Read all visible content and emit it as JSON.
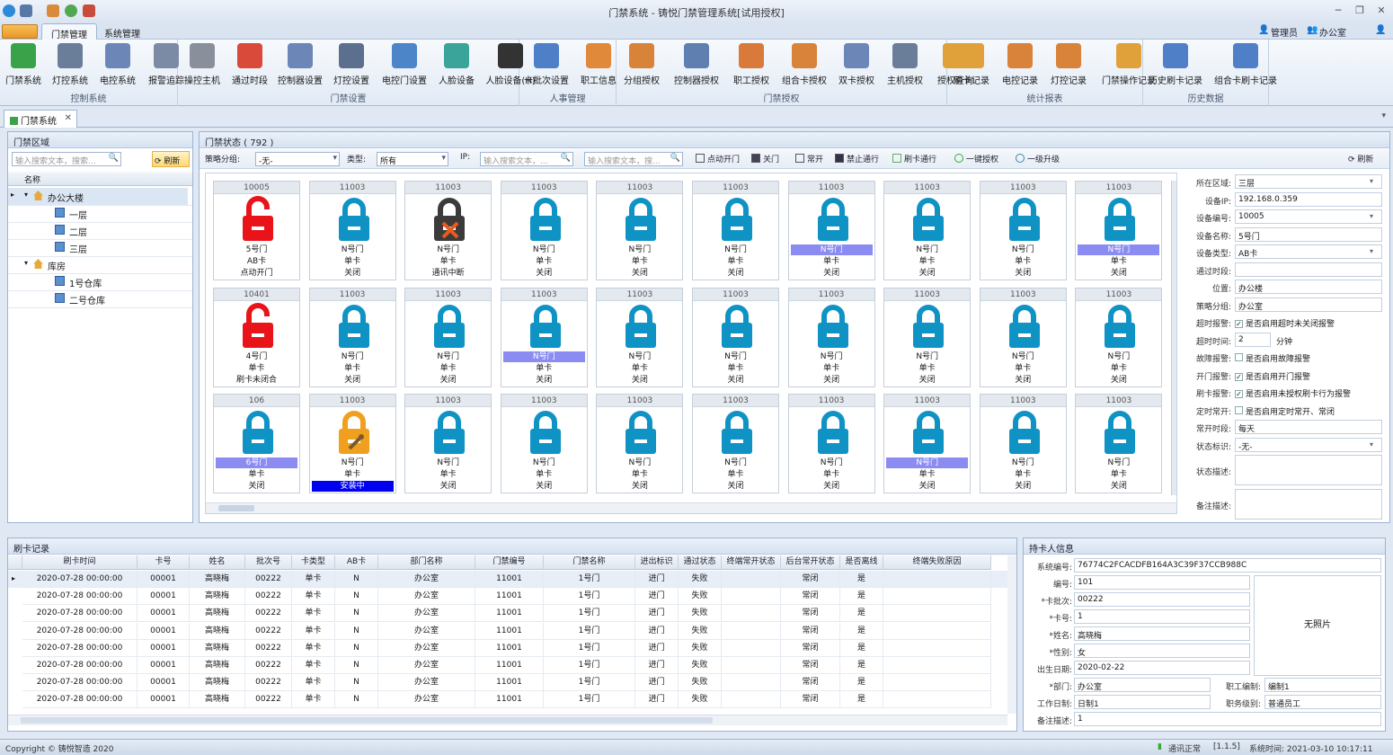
{
  "app": {
    "title": "门禁系统 - 铸悦门禁管理系统[试用授权]"
  },
  "menu": {
    "tabs": [
      "门禁管理",
      "系统管理"
    ],
    "user": "管理员",
    "dept": "办公室"
  },
  "ribbon": {
    "groups": [
      {
        "label": "控制系统",
        "buttons": [
          {
            "label": "门禁系统",
            "color": "#3aa34a"
          },
          {
            "label": "灯控系统",
            "color": "#6b7e99"
          },
          {
            "label": "电控系统",
            "color": "#6d86b8"
          },
          {
            "label": "报警追踪",
            "color": "#7b8aa5"
          }
        ]
      },
      {
        "label": "门禁设置",
        "buttons": [
          {
            "label": "操控主机",
            "color": "#8a8f9c"
          },
          {
            "label": "通过时段",
            "color": "#d94a3a"
          },
          {
            "label": "控制器设置",
            "color": "#6d86b8"
          },
          {
            "label": "灯控设置",
            "color": "#5d6f8e"
          },
          {
            "label": "电控门设置",
            "color": "#4d85c9"
          },
          {
            "label": "人脸设备",
            "color": "#3aa39a"
          },
          {
            "label": "人脸设备(H)",
            "color": "#333333"
          }
        ]
      },
      {
        "label": "人事管理",
        "buttons": [
          {
            "label": "卡批次设置",
            "color": "#4f7fc7"
          },
          {
            "label": "职工信息",
            "color": "#e0893a"
          }
        ]
      },
      {
        "label": "门禁授权",
        "buttons": [
          {
            "label": "分组授权",
            "color": "#d9823a"
          },
          {
            "label": "控制器授权",
            "color": "#5f7fb0"
          },
          {
            "label": "职工授权",
            "color": "#d97a3a"
          },
          {
            "label": "组合卡授权",
            "color": "#d9823a"
          },
          {
            "label": "双卡授权",
            "color": "#6d86b8"
          },
          {
            "label": "主机授权",
            "color": "#6b7e99"
          },
          {
            "label": "授权查询",
            "color": "#e0a03a"
          }
        ]
      },
      {
        "label": "统计报表",
        "buttons": [
          {
            "label": "刷卡记录",
            "color": "#e0a03a"
          },
          {
            "label": "电控记录",
            "color": "#d9823a"
          },
          {
            "label": "灯控记录",
            "color": "#d9823a"
          },
          {
            "label": "门禁操作记录",
            "color": "#e0a03a"
          }
        ]
      },
      {
        "label": "历史数据",
        "buttons": [
          {
            "label": "历史刷卡记录",
            "color": "#4f7fc7"
          },
          {
            "label": "组合卡刷卡记录",
            "color": "#4f7fc7"
          }
        ]
      }
    ]
  },
  "doc_tab": "门禁系统",
  "area_panel": {
    "title": "门禁区域",
    "search_placeholder": "输入搜索文本，搜索...",
    "refresh": "刷新",
    "col_name": "名称",
    "tree": [
      {
        "label": "办公大楼",
        "level": 0,
        "type": "building"
      },
      {
        "label": "一层",
        "level": 1,
        "type": "floor"
      },
      {
        "label": "二层",
        "level": 1,
        "type": "floor"
      },
      {
        "label": "三层",
        "level": 1,
        "type": "floor"
      },
      {
        "label": "库房",
        "level": 0,
        "type": "building"
      },
      {
        "label": "1号仓库",
        "level": 1,
        "type": "floor"
      },
      {
        "label": "二号仓库",
        "level": 1,
        "type": "floor"
      }
    ]
  },
  "status_panel": {
    "title": "门禁状态 ( 792 )",
    "group_label": "策略分组:",
    "group_value": "-无-",
    "type_label": "类型:",
    "type_value": "所有",
    "ip_label": "IP:",
    "ip_placeholder": "输入搜索文本，...",
    "search_placeholder": "输入搜索文本，搜...",
    "actions": [
      "点动开门",
      "关门",
      "常开",
      "禁止通行",
      "刷卡通行",
      "一键授权",
      "一级升级"
    ],
    "refresh": "刷新",
    "doors": [
      {
        "id": "10005",
        "name": "5号门",
        "type": "AB卡",
        "status": "点动开门",
        "icon": "open-red",
        "hl": false,
        "inst": false
      },
      {
        "id": "11003",
        "name": "N号门",
        "type": "单卡",
        "status": "关闭",
        "icon": "closed",
        "hl": false,
        "inst": false
      },
      {
        "id": "11003",
        "name": "N号门",
        "type": "单卡",
        "status": "通讯中断",
        "icon": "offline",
        "hl": false,
        "inst": false
      },
      {
        "id": "11003",
        "name": "N号门",
        "type": "单卡",
        "status": "关闭",
        "icon": "closed",
        "hl": false,
        "inst": false
      },
      {
        "id": "11003",
        "name": "N号门",
        "type": "单卡",
        "status": "关闭",
        "icon": "closed",
        "hl": false,
        "inst": false
      },
      {
        "id": "11003",
        "name": "N号门",
        "type": "单卡",
        "status": "关闭",
        "icon": "closed",
        "hl": false,
        "inst": false
      },
      {
        "id": "11003",
        "name": "N号门",
        "type": "单卡",
        "status": "关闭",
        "icon": "closed",
        "hl": true,
        "inst": false
      },
      {
        "id": "11003",
        "name": "N号门",
        "type": "单卡",
        "status": "关闭",
        "icon": "closed",
        "hl": false,
        "inst": false
      },
      {
        "id": "11003",
        "name": "N号门",
        "type": "单卡",
        "status": "关闭",
        "icon": "closed",
        "hl": false,
        "inst": false
      },
      {
        "id": "11003",
        "name": "N号门",
        "type": "单卡",
        "status": "关闭",
        "icon": "closed",
        "hl": true,
        "inst": false
      },
      {
        "id": "10401",
        "name": "4号门",
        "type": "单卡",
        "status": "刷卡未闭合",
        "icon": "open-red",
        "hl": false,
        "inst": false
      },
      {
        "id": "11003",
        "name": "N号门",
        "type": "单卡",
        "status": "关闭",
        "icon": "closed",
        "hl": false,
        "inst": false
      },
      {
        "id": "11003",
        "name": "N号门",
        "type": "单卡",
        "status": "关闭",
        "icon": "closed",
        "hl": false,
        "inst": false
      },
      {
        "id": "11003",
        "name": "N号门",
        "type": "单卡",
        "status": "关闭",
        "icon": "closed",
        "hl": true,
        "inst": false
      },
      {
        "id": "11003",
        "name": "N号门",
        "type": "单卡",
        "status": "关闭",
        "icon": "closed",
        "hl": false,
        "inst": false
      },
      {
        "id": "11003",
        "name": "N号门",
        "type": "单卡",
        "status": "关闭",
        "icon": "closed",
        "hl": false,
        "inst": false
      },
      {
        "id": "11003",
        "name": "N号门",
        "type": "单卡",
        "status": "关闭",
        "icon": "closed",
        "hl": false,
        "inst": false
      },
      {
        "id": "11003",
        "name": "N号门",
        "type": "单卡",
        "status": "关闭",
        "icon": "closed",
        "hl": false,
        "inst": false
      },
      {
        "id": "11003",
        "name": "N号门",
        "type": "单卡",
        "status": "关闭",
        "icon": "closed",
        "hl": false,
        "inst": false
      },
      {
        "id": "11003",
        "name": "N号门",
        "type": "单卡",
        "status": "关闭",
        "icon": "closed",
        "hl": false,
        "inst": false
      },
      {
        "id": "106",
        "name": "6号门",
        "type": "单卡",
        "status": "关闭",
        "icon": "closed",
        "hl": true,
        "inst": false
      },
      {
        "id": "11003",
        "name": "N号门",
        "type": "单卡",
        "status": "安装中",
        "icon": "install",
        "hl": false,
        "inst": true
      },
      {
        "id": "11003",
        "name": "N号门",
        "type": "单卡",
        "status": "关闭",
        "icon": "closed",
        "hl": false,
        "inst": false
      },
      {
        "id": "11003",
        "name": "N号门",
        "type": "单卡",
        "status": "关闭",
        "icon": "closed",
        "hl": false,
        "inst": false
      },
      {
        "id": "11003",
        "name": "N号门",
        "type": "单卡",
        "status": "关闭",
        "icon": "closed",
        "hl": false,
        "inst": false
      },
      {
        "id": "11003",
        "name": "N号门",
        "type": "单卡",
        "status": "关闭",
        "icon": "closed",
        "hl": false,
        "inst": false
      },
      {
        "id": "11003",
        "name": "N号门",
        "type": "单卡",
        "status": "关闭",
        "icon": "closed",
        "hl": false,
        "inst": false
      },
      {
        "id": "11003",
        "name": "N号门",
        "type": "单卡",
        "status": "关闭",
        "icon": "closed",
        "hl": true,
        "inst": false
      },
      {
        "id": "11003",
        "name": "N号门",
        "type": "单卡",
        "status": "关闭",
        "icon": "closed",
        "hl": false,
        "inst": false
      },
      {
        "id": "11003",
        "name": "N号门",
        "type": "单卡",
        "status": "关闭",
        "icon": "closed",
        "hl": false,
        "inst": false
      }
    ]
  },
  "properties": [
    {
      "label": "所在区域:",
      "value": "三层",
      "kind": "combo"
    },
    {
      "label": "设备IP:",
      "value": "192.168.0.359",
      "kind": "text"
    },
    {
      "label": "设备编号:",
      "value": "10005",
      "kind": "spin"
    },
    {
      "label": "设备名称:",
      "value": "5号门",
      "kind": "text"
    },
    {
      "label": "设备类型:",
      "value": "AB卡",
      "kind": "combo"
    },
    {
      "label": "通过时段:",
      "value": "",
      "kind": "text"
    },
    {
      "label": "位置:",
      "value": "办公楼",
      "kind": "text"
    },
    {
      "label": "策略分组:",
      "value": "办公室",
      "kind": "text"
    },
    {
      "label": "超时报警:",
      "value": "是否启用超时未关闭报警",
      "kind": "check",
      "checked": true
    },
    {
      "label": "超时时间:",
      "value": "2",
      "unit": "分钟",
      "kind": "spinunit"
    },
    {
      "label": "故障报警:",
      "value": "是否启用故障报警",
      "kind": "check",
      "checked": false
    },
    {
      "label": "开门报警:",
      "value": "是否启用开门报警",
      "kind": "check",
      "checked": true
    },
    {
      "label": "刷卡报警:",
      "value": "是否启用未授权刷卡行为报警",
      "kind": "check",
      "checked": true
    },
    {
      "label": "定时常开:",
      "value": "是否启用定时常开、常闭",
      "kind": "check",
      "checked": false
    },
    {
      "label": "常开时段:",
      "value": "每天",
      "kind": "text"
    },
    {
      "label": "状态标识:",
      "value": "-无-",
      "kind": "combo"
    },
    {
      "label": "状态描述:",
      "value": "",
      "kind": "memo"
    },
    {
      "label": "备注描述:",
      "value": "",
      "kind": "memo"
    }
  ],
  "records": {
    "title": "刷卡记录",
    "columns": [
      "刷卡时间",
      "卡号",
      "姓名",
      "批次号",
      "卡类型",
      "AB卡",
      "部门名称",
      "门禁编号",
      "门禁名称",
      "进出标识",
      "通过状态",
      "终端常开状态",
      "后台常开状态",
      "是否离线",
      "终端失败原因"
    ],
    "rows": [
      [
        "2020-07-28 00:00:00",
        "00001",
        "高晓梅",
        "00222",
        "单卡",
        "N",
        "办公室",
        "11001",
        "1号门",
        "进门",
        "失败",
        "",
        "常闭",
        "是",
        ""
      ],
      [
        "2020-07-28 00:00:00",
        "00001",
        "高晓梅",
        "00222",
        "单卡",
        "N",
        "办公室",
        "11001",
        "1号门",
        "进门",
        "失败",
        "",
        "常闭",
        "是",
        ""
      ],
      [
        "2020-07-28 00:00:00",
        "00001",
        "高晓梅",
        "00222",
        "单卡",
        "N",
        "办公室",
        "11001",
        "1号门",
        "进门",
        "失败",
        "",
        "常闭",
        "是",
        ""
      ],
      [
        "2020-07-28 00:00:00",
        "00001",
        "高晓梅",
        "00222",
        "单卡",
        "N",
        "办公室",
        "11001",
        "1号门",
        "进门",
        "失败",
        "",
        "常闭",
        "是",
        ""
      ],
      [
        "2020-07-28 00:00:00",
        "00001",
        "高晓梅",
        "00222",
        "单卡",
        "N",
        "办公室",
        "11001",
        "1号门",
        "进门",
        "失败",
        "",
        "常闭",
        "是",
        ""
      ],
      [
        "2020-07-28 00:00:00",
        "00001",
        "高晓梅",
        "00222",
        "单卡",
        "N",
        "办公室",
        "11001",
        "1号门",
        "进门",
        "失败",
        "",
        "常闭",
        "是",
        ""
      ],
      [
        "2020-07-28 00:00:00",
        "00001",
        "高晓梅",
        "00222",
        "单卡",
        "N",
        "办公室",
        "11001",
        "1号门",
        "进门",
        "失败",
        "",
        "常闭",
        "是",
        ""
      ],
      [
        "2020-07-28 00:00:00",
        "00001",
        "高晓梅",
        "00222",
        "单卡",
        "N",
        "办公室",
        "11001",
        "1号门",
        "进门",
        "失败",
        "",
        "常闭",
        "是",
        ""
      ]
    ]
  },
  "cardholder": {
    "title": "持卡人信息",
    "sys_label": "系统编号:",
    "sys_value": "76774C2FCACDFB164A3C39F37CCB988C",
    "no_label": "编号:",
    "no_value": "101",
    "batch_label": "*卡批次:",
    "batch_value": "00222",
    "card_label": "*卡号:",
    "card_value": "1",
    "name_label": "*姓名:",
    "name_value": "高晓梅",
    "sex_label": "*性别:",
    "sex_value": "女",
    "birth_label": "出生日期:",
    "birth_value": "2020-02-22",
    "dept_label": "*部门:",
    "dept_value": "办公室",
    "staffing_label": "职工编制:",
    "staffing_value": "编制1",
    "shift_label": "工作日制:",
    "shift_value": "日制1",
    "rank_label": "职务级别:",
    "rank_value": "普通员工",
    "note_label": "备注描述:",
    "note_value": "1",
    "photo": "无照片"
  },
  "status_bar": {
    "copyright": "Copyright © 铸悦智造 2020",
    "comm": "通讯正常",
    "version": "[1.1.5]",
    "time": "系统时间: 2021-03-10 10:17:11"
  }
}
